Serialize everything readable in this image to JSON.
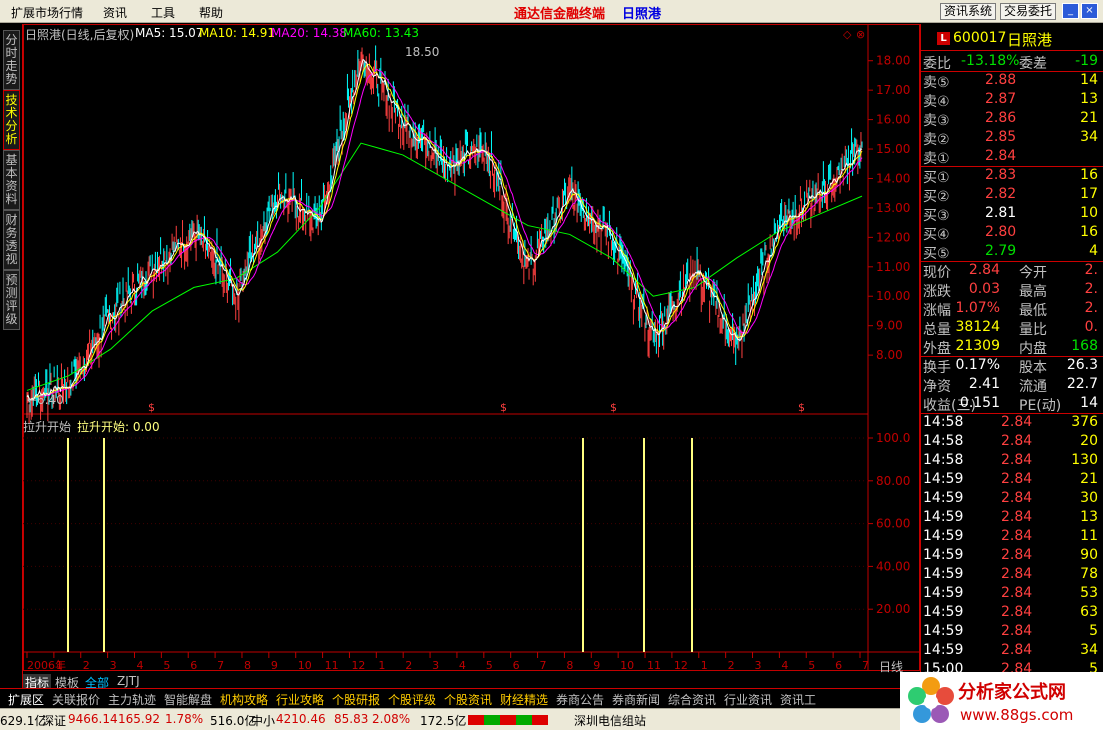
{
  "menu": {
    "items": [
      "扩展市场行情",
      "资讯",
      "工具",
      "帮助"
    ],
    "app_title": "通达信金融终端",
    "stock_title": "日照港",
    "buttons": [
      "资讯系统",
      "交易委托"
    ]
  },
  "left_tabs": [
    "分时走势",
    "技术分析",
    "基本资料",
    "财务透视",
    "预测评级"
  ],
  "chart": {
    "header_name": "日照港(日线,后复权)",
    "ma5": "MA5: 15.07",
    "ma10": "MA10: 14.91",
    "ma20": "MA20: 14.38",
    "ma60": "MA60: 13.43",
    "high_label": "18.50",
    "low_label": "6.40",
    "indicator_name": "拉升开始",
    "indicator_value": "拉升开始: 0.00",
    "period_label": "日线",
    "bottom_tabs": [
      "指标",
      "模板",
      "全部",
      "ZJTJ"
    ],
    "colors": {
      "ma5": "#ffffff",
      "ma10": "#ffff00",
      "ma20": "#ff00ff",
      "ma60": "#00ff00",
      "up": "#ff4040",
      "down": "#00ffff",
      "indicator": "#ffff80"
    }
  },
  "chart_data": [
    {
      "type": "line",
      "title": "日照港(日线,后复权)",
      "xlabel": "",
      "ylabel": "",
      "ylim": [
        6.0,
        18.5
      ],
      "y_ticks": [
        "8.00",
        "9.00",
        "10.00",
        "11.00",
        "12.00",
        "13.00",
        "14.00",
        "15.00",
        "16.00",
        "17.00",
        "18.00"
      ],
      "x_ticks": [
        "2006年",
        "1",
        "2",
        "3",
        "4",
        "5",
        "6",
        "7",
        "8",
        "9",
        "10",
        "11",
        "12",
        "1",
        "2",
        "3",
        "4",
        "5",
        "6",
        "7",
        "8",
        "9",
        "10",
        "11",
        "12",
        "1",
        "2",
        "3",
        "4",
        "5",
        "6",
        "7"
      ],
      "series": [
        {
          "name": "MA60",
          "values": [
            6.8,
            7.3,
            8.2,
            9.5,
            10.3,
            10.6,
            11.5,
            13.0,
            15.2,
            14.8,
            14.0,
            13.2,
            12.4,
            12.1,
            11.3,
            10.0,
            10.3,
            11.3,
            12.2,
            12.8,
            13.4
          ]
        },
        {
          "name": "价格",
          "values": [
            6.6,
            7.0,
            9.3,
            11.0,
            12.2,
            10.1,
            13.5,
            12.5,
            18.2,
            16.0,
            14.5,
            15.0,
            11.0,
            13.5,
            12.0,
            8.6,
            11.0,
            8.3,
            12.5,
            13.5,
            15.1
          ]
        }
      ]
    },
    {
      "type": "bar",
      "title": "拉升开始",
      "ylim": [
        0,
        100
      ],
      "y_ticks": [
        "20.00",
        "40.00",
        "60.00",
        "80.00",
        "100.0"
      ],
      "series": [
        {
          "name": "拉升开始",
          "values": [
            100,
            100,
            100,
            100,
            100
          ]
        }
      ]
    }
  ],
  "quote": {
    "code": "600017",
    "name": "日照港",
    "weibi_label": "委比",
    "weibi": "-13.18%",
    "weicha_label": "委差",
    "weicha": "-19",
    "asks": [
      {
        "label": "卖⑤",
        "price": "2.88",
        "vol": "14"
      },
      {
        "label": "卖④",
        "price": "2.87",
        "vol": "13"
      },
      {
        "label": "卖③",
        "price": "2.86",
        "vol": "21"
      },
      {
        "label": "卖②",
        "price": "2.85",
        "vol": "34"
      },
      {
        "label": "卖①",
        "price": "2.84",
        "vol": ""
      }
    ],
    "bids": [
      {
        "label": "买①",
        "price": "2.83",
        "vol": "16"
      },
      {
        "label": "买②",
        "price": "2.82",
        "vol": "17"
      },
      {
        "label": "买③",
        "price": "2.81",
        "vol": "10"
      },
      {
        "label": "买④",
        "price": "2.80",
        "vol": "16"
      },
      {
        "label": "买⑤",
        "price": "2.79",
        "vol": "4"
      }
    ],
    "stats": [
      {
        "l1": "现价",
        "v1": "2.84",
        "l2": "今开",
        "v2": "2."
      },
      {
        "l1": "涨跌",
        "v1": "0.03",
        "l2": "最高",
        "v2": "2."
      },
      {
        "l1": "涨幅",
        "v1": "1.07%",
        "l2": "最低",
        "v2": "2."
      },
      {
        "l1": "总量",
        "v1": "38124",
        "l2": "量比",
        "v2": "0."
      },
      {
        "l1": "外盘",
        "v1": "21309",
        "l2": "内盘",
        "v2": "168"
      }
    ],
    "stats2": [
      {
        "l1": "换手",
        "v1": "0.17%",
        "l2": "股本",
        "v2": "26.3"
      },
      {
        "l1": "净资",
        "v1": "2.41",
        "l2": "流通",
        "v2": "22.7"
      },
      {
        "l1": "收益(三)",
        "v1": "0.151",
        "l2": "PE(动)",
        "v2": "14"
      }
    ],
    "ticks": [
      {
        "t": "14:58",
        "p": "2.84",
        "v": "376"
      },
      {
        "t": "14:58",
        "p": "2.84",
        "v": "20"
      },
      {
        "t": "14:58",
        "p": "2.84",
        "v": "130"
      },
      {
        "t": "14:59",
        "p": "2.84",
        "v": "21"
      },
      {
        "t": "14:59",
        "p": "2.84",
        "v": "30"
      },
      {
        "t": "14:59",
        "p": "2.84",
        "v": "13"
      },
      {
        "t": "14:59",
        "p": "2.84",
        "v": "11"
      },
      {
        "t": "14:59",
        "p": "2.84",
        "v": "90"
      },
      {
        "t": "14:59",
        "p": "2.84",
        "v": "78"
      },
      {
        "t": "14:59",
        "p": "2.84",
        "v": "53"
      },
      {
        "t": "14:59",
        "p": "2.84",
        "v": "63"
      },
      {
        "t": "14:59",
        "p": "2.84",
        "v": "5"
      },
      {
        "t": "14:59",
        "p": "2.84",
        "v": "34"
      },
      {
        "t": "15:00",
        "p": "2.84",
        "v": "5"
      }
    ]
  },
  "bottom_tabs": [
    "扩展区",
    "关联报价",
    "主力轨迹",
    "智能解盘",
    "机构攻略",
    "行业攻略",
    "个股研报",
    "个股评级",
    "个股资讯",
    "财经精选",
    "券商公告",
    "券商新闻",
    "综合资讯",
    "行业资讯",
    "资讯工"
  ],
  "status": {
    "s1": "629.1亿",
    "s2": "深证",
    "s3": "9466.14",
    "s4": "165.92",
    "s5": "1.78%",
    "s6": "516.0亿",
    "s7": "中小",
    "s8": "4210.46",
    "s9": "85.83",
    "s10": "2.08%",
    "s11": "172.5亿",
    "s12": "深圳电信组站"
  },
  "logo": {
    "text": "分析家公式网",
    "url": "www.88gs.com"
  }
}
